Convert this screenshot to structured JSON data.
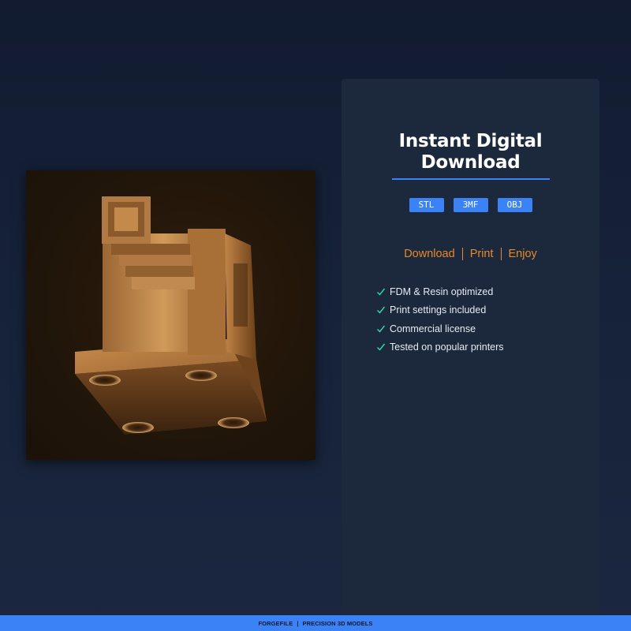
{
  "product_image": {
    "icon": "3d-printed-bracket-render"
  },
  "panel": {
    "title_line1": "Instant Digital",
    "title_line2": "Download",
    "formats": [
      "STL",
      "3MF",
      "OBJ"
    ],
    "steps": [
      "Download",
      "Print",
      "Enjoy"
    ],
    "features": [
      "FDM & Resin optimized",
      "Print settings included",
      "Commercial license",
      "Tested on popular printers"
    ]
  },
  "footer": {
    "brand": "FORGEFILE",
    "separator": "|",
    "tagline": "PRECISION 3D MODELS"
  },
  "colors": {
    "accent": "#3b82f6",
    "step_text": "#e58a2a",
    "check": "#2dd4a7",
    "panel_bg": "#1c283c",
    "page_bg": "#162239"
  }
}
